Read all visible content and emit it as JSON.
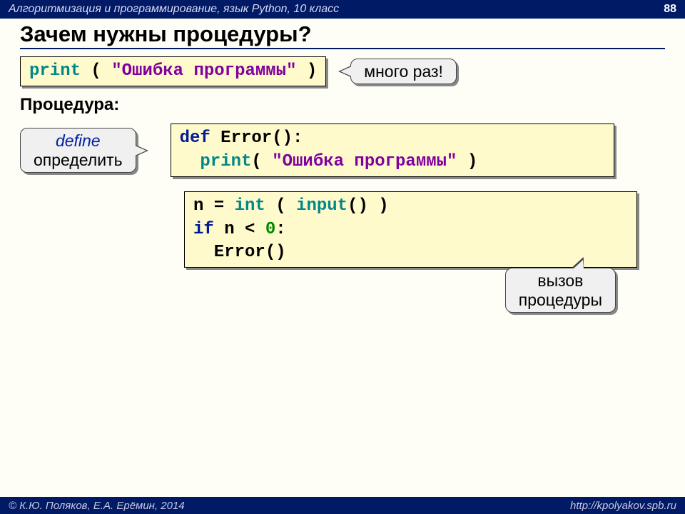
{
  "header": {
    "course": "Алгоритмизация и программирование, язык Python, 10 класс",
    "page": "88"
  },
  "title": "Зачем нужны процедуры?",
  "call1": {
    "p1": "print",
    "p2": " ( ",
    "p3": "\"Ошибка программы\"",
    "p4": " )"
  },
  "annot1": "много раз!",
  "subheading": "Процедура:",
  "annot2a": "define",
  "annot2b": "определить",
  "block1": {
    "l1a": "def",
    "l1b": " Error()",
    "l1c": ":",
    "l2a": "  print",
    "l2b": "( ",
    "l2c": "\"Ошибка программы\"",
    "l2d": " )"
  },
  "block2": {
    "l1a": "n",
    "l1b": " = ",
    "l1c": "int",
    "l1d": " ( ",
    "l1e": "input",
    "l1f": "() )",
    "l2a": "if",
    "l2b": " n < ",
    "l2c": "0",
    "l2d": ":",
    "l3": "  Error()"
  },
  "annot3a": "вызов",
  "annot3b": "процедуры",
  "footer": {
    "left": "© К.Ю. Поляков, Е.А. Ерёмин, 2014",
    "right": "http://kpolyakov.spb.ru"
  }
}
